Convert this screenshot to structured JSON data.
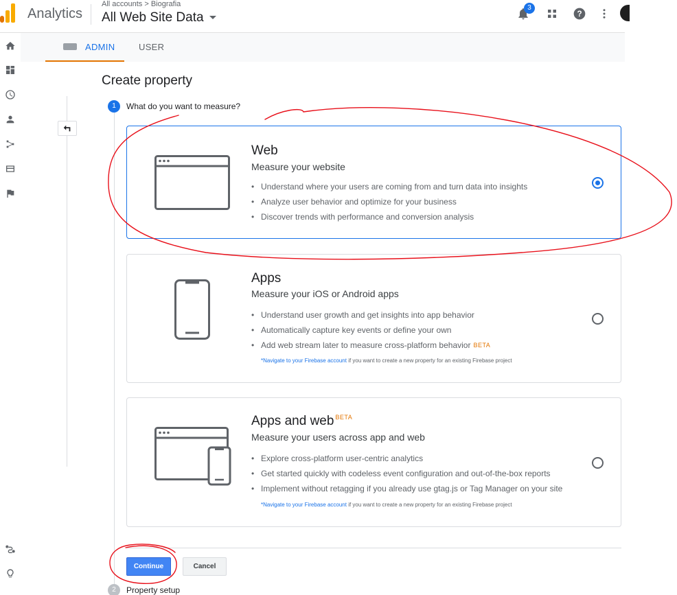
{
  "header": {
    "app_name": "Analytics",
    "breadcrumb": "All accounts > Biografia",
    "view_name": "All Web Site Data",
    "notification_count": "3"
  },
  "tabs": {
    "admin": "ADMIN",
    "user": "USER"
  },
  "page": {
    "title": "Create property",
    "step1_label": "What do you want to measure?",
    "step1_num": "1",
    "step2_label": "Property setup",
    "step2_num": "2"
  },
  "cards": {
    "web": {
      "title": "Web",
      "subtitle": "Measure your website",
      "bullets": [
        "Understand where your users are coming from and turn data into insights",
        "Analyze user behavior and optimize for your business",
        "Discover trends with performance and conversion analysis"
      ]
    },
    "apps": {
      "title": "Apps",
      "subtitle": "Measure your iOS or Android apps",
      "bullets": [
        "Understand user growth and get insights into app behavior",
        "Automatically capture key events or define your own",
        "Add web stream later to measure cross-platform behavior"
      ],
      "beta": "BETA",
      "note_link": "*Navigate to your Firebase account",
      "note_text": " if you want to create a new property for an existing Firebase project"
    },
    "apps_web": {
      "title": "Apps and web",
      "beta": "BETA",
      "subtitle": "Measure your users across app and web",
      "bullets": [
        "Explore cross-platform user-centric analytics",
        "Get started quickly with codeless event configuration and out-of-the-box reports",
        "Implement without retagging if you already use gtag.js or Tag Manager on your site"
      ],
      "note_link": "*Navigate to your Firebase account",
      "note_text": " if you want to create a new property for an existing Firebase project"
    }
  },
  "buttons": {
    "continue": "Continue",
    "cancel": "Cancel"
  },
  "colors": {
    "accent": "#1a73e8",
    "beta": "#e37400",
    "annotation": "#e8101a"
  }
}
